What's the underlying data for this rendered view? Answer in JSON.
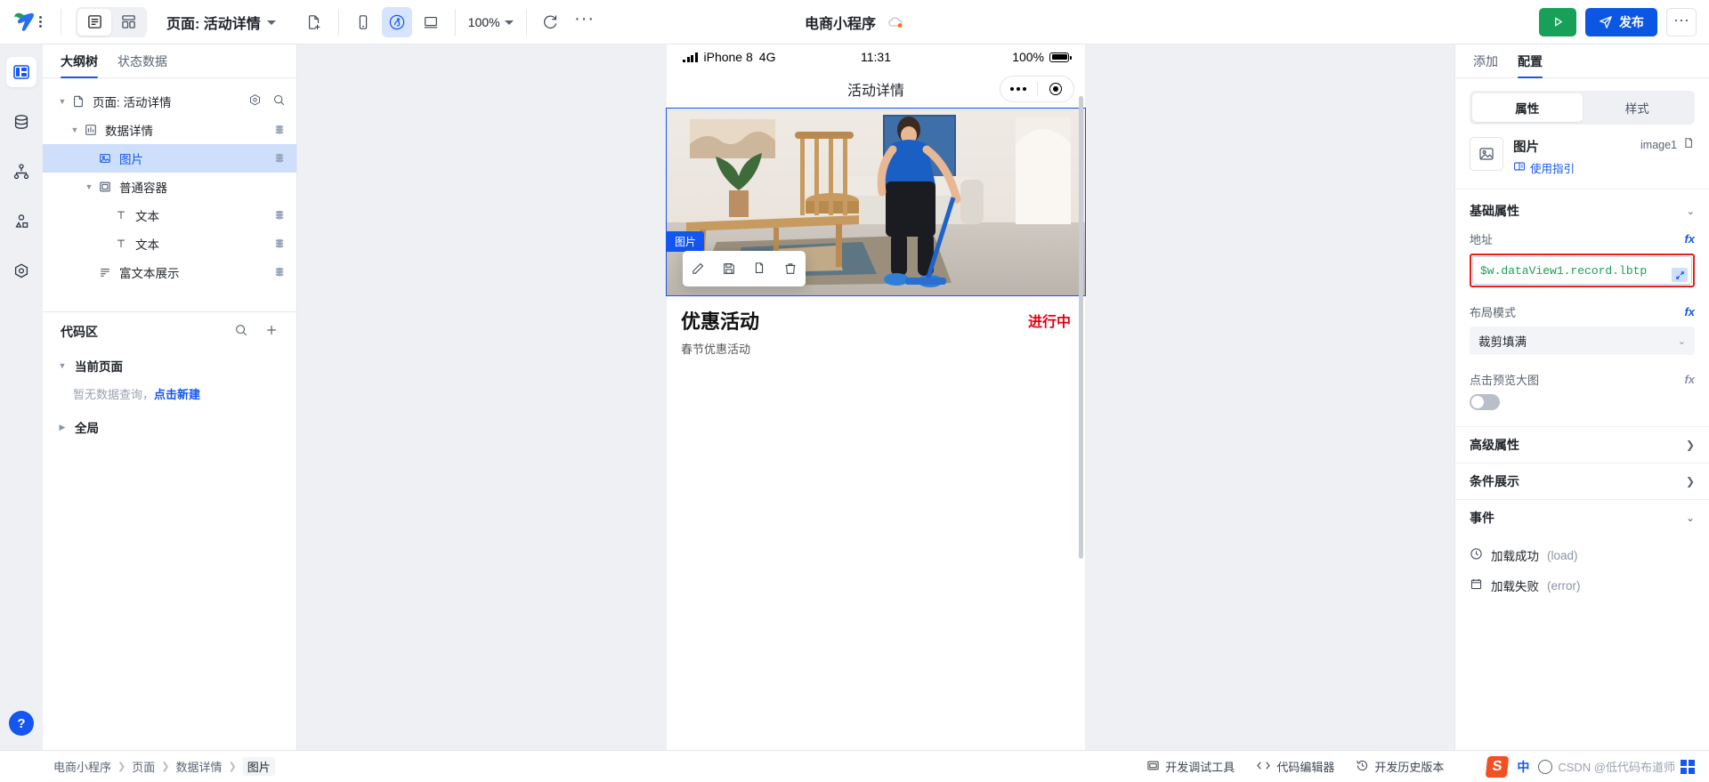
{
  "topbar": {
    "logo_name": "app-logo",
    "view_mode_buttons": [
      {
        "name": "outline-view",
        "icon": "list-panel-icon",
        "active": true
      },
      {
        "name": "grid-view",
        "icon": "grid-icon",
        "active": false
      }
    ],
    "page_selector_label": "页面: 活动详情",
    "new_page_icon": "file-plus-icon",
    "device_buttons": [
      {
        "name": "mobile-device",
        "icon": "phone-icon",
        "active": false
      },
      {
        "name": "miniprogram-device",
        "icon": "wechat-icon",
        "active": true
      },
      {
        "name": "desktop-device",
        "icon": "monitor-icon",
        "active": false
      }
    ],
    "zoom_level": "100%",
    "refresh_icon": "refresh-icon",
    "more_label": "···",
    "project_title": "电商小程序",
    "cloud_icon": "cloud-icon",
    "run_label": "▶",
    "publish_label": "发布",
    "overflow_label": "···"
  },
  "rail": {
    "items": [
      {
        "name": "sidebar-item-pages",
        "icon": "layout-panel-icon",
        "active": true
      },
      {
        "name": "sidebar-item-data",
        "icon": "database-icon",
        "active": false
      },
      {
        "name": "sidebar-item-flow",
        "icon": "sitemap-icon",
        "active": false
      },
      {
        "name": "sidebar-item-components",
        "icon": "shapes-icon",
        "active": false
      },
      {
        "name": "sidebar-item-settings",
        "icon": "hexagon-gear-icon",
        "active": false
      }
    ],
    "help_label": "?"
  },
  "left_panel": {
    "tabs": [
      {
        "label": "大纲树",
        "active": true
      },
      {
        "label": "状态数据",
        "active": false
      }
    ],
    "tree_actions": [
      {
        "name": "tree-settings-icon",
        "icon": "hexagon-gear-icon"
      },
      {
        "name": "tree-search-icon",
        "icon": "search-icon"
      }
    ],
    "tree": [
      {
        "label": "页面: 活动详情",
        "icon": "file-icon",
        "depth": 0,
        "caret": "down",
        "selected": false,
        "badge": false
      },
      {
        "label": "数据详情",
        "icon": "chart-icon",
        "depth": 1,
        "caret": "down",
        "selected": false,
        "badge": true
      },
      {
        "label": "图片",
        "icon": "image-icon",
        "depth": 2,
        "caret": "none",
        "selected": true,
        "badge": true
      },
      {
        "label": "普通容器",
        "icon": "container-icon",
        "depth": 2,
        "caret": "down",
        "selected": false,
        "badge": false
      },
      {
        "label": "文本",
        "icon": "text-icon",
        "depth": 3,
        "caret": "none",
        "selected": false,
        "badge": true
      },
      {
        "label": "文本",
        "icon": "text-icon",
        "depth": 3,
        "caret": "none",
        "selected": false,
        "badge": true
      },
      {
        "label": "富文本展示",
        "icon": "richtext-icon",
        "depth": 2,
        "caret": "none",
        "selected": false,
        "badge": true
      }
    ],
    "code_area": {
      "title": "代码区",
      "search_icon": "search-icon",
      "add_icon": "plus-icon",
      "current_page_label": "当前页面",
      "empty_text": "暂无数据查询，",
      "empty_link": "点击新建",
      "global_label": "全局"
    }
  },
  "canvas": {
    "status_bar": {
      "device": "iPhone 8",
      "network": "4G",
      "time": "11:31",
      "battery_pct": "100%"
    },
    "nav_title": "活动详情",
    "selection_tag": "图片",
    "selection_toolbar": [
      {
        "name": "edit-icon",
        "glyph": "pencil"
      },
      {
        "name": "save-icon",
        "glyph": "save"
      },
      {
        "name": "copy-icon",
        "glyph": "copy"
      },
      {
        "name": "delete-icon",
        "glyph": "trash"
      }
    ],
    "activity_title": "优惠活动",
    "activity_status": "进行中",
    "activity_sub": "春节优惠活动"
  },
  "right_panel": {
    "tabs": [
      {
        "label": "添加",
        "active": false
      },
      {
        "label": "配置",
        "active": true
      }
    ],
    "segments": [
      {
        "label": "属性",
        "active": true
      },
      {
        "label": "样式",
        "active": false
      }
    ],
    "component": {
      "thumb_icon": "image-icon",
      "name": "图片",
      "guide_icon": "book-icon",
      "guide_label": "使用指引",
      "id": "image1",
      "copy_icon": "copy-icon"
    },
    "basic_section": {
      "title": "基础属性",
      "chevron": "chevron-down-icon",
      "fields": [
        {
          "label": "地址",
          "fx": "fx",
          "type": "code-input",
          "value": "$w.dataView1.record.lbtp",
          "highlighted": true,
          "expand_icon": "expand-icon"
        },
        {
          "label": "布局模式",
          "fx": "fx",
          "type": "select",
          "value": "裁剪填满"
        },
        {
          "label": "点击预览大图",
          "fx": "fx",
          "type": "toggle",
          "value": "off"
        }
      ]
    },
    "accordions": [
      {
        "label": "高级属性",
        "chevron": "chevron-right-icon"
      },
      {
        "label": "条件展示",
        "chevron": "chevron-right-icon"
      },
      {
        "label": "事件",
        "chevron": "chevron-down-icon"
      }
    ],
    "events": [
      {
        "icon": "clock-icon",
        "label": "加载成功",
        "code": "(load)"
      },
      {
        "icon": "calendar-icon",
        "label": "加载失败",
        "code": "(error)"
      }
    ]
  },
  "bottom_bar": {
    "breadcrumb": [
      "电商小程序",
      "页面",
      "数据详情",
      "图片"
    ],
    "tools": [
      {
        "icon": "window-icon",
        "label": "开发调试工具"
      },
      {
        "icon": "code-icon",
        "label": "代码编辑器"
      },
      {
        "icon": "history-icon",
        "label": "开发历史版本"
      }
    ],
    "ime": {
      "brand": "S",
      "mode": "中",
      "watermark": "CSDN @低代码布道师"
    }
  },
  "colors": {
    "accent": "#1456f0",
    "publish": "#0b57e3",
    "run": "#18a058",
    "highlight": "#e52020",
    "status_red": "#e60012",
    "code_green": "#18a058"
  }
}
